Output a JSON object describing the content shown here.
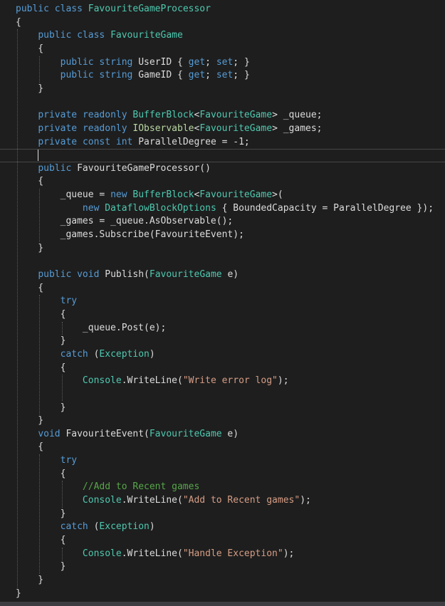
{
  "editor": {
    "lines": [
      [
        {
          "t": "public",
          "c": "kw"
        },
        {
          "t": " ",
          "c": "pl"
        },
        {
          "t": "class",
          "c": "kw"
        },
        {
          "t": " ",
          "c": "pl"
        },
        {
          "t": "FavouriteGameProcessor",
          "c": "typ"
        }
      ],
      [
        {
          "t": "{",
          "c": "pl"
        }
      ],
      [
        {
          "t": "    ",
          "c": "pl"
        },
        {
          "t": "public",
          "c": "kw"
        },
        {
          "t": " ",
          "c": "pl"
        },
        {
          "t": "class",
          "c": "kw"
        },
        {
          "t": " ",
          "c": "pl"
        },
        {
          "t": "FavouriteGame",
          "c": "typ"
        }
      ],
      [
        {
          "t": "    {",
          "c": "pl"
        }
      ],
      [
        {
          "t": "        ",
          "c": "pl"
        },
        {
          "t": "public",
          "c": "kw"
        },
        {
          "t": " ",
          "c": "pl"
        },
        {
          "t": "string",
          "c": "kw"
        },
        {
          "t": " UserID { ",
          "c": "pl"
        },
        {
          "t": "get",
          "c": "kw"
        },
        {
          "t": "; ",
          "c": "pl"
        },
        {
          "t": "set",
          "c": "kw"
        },
        {
          "t": "; }",
          "c": "pl"
        }
      ],
      [
        {
          "t": "        ",
          "c": "pl"
        },
        {
          "t": "public",
          "c": "kw"
        },
        {
          "t": " ",
          "c": "pl"
        },
        {
          "t": "string",
          "c": "kw"
        },
        {
          "t": " GameID { ",
          "c": "pl"
        },
        {
          "t": "get",
          "c": "kw"
        },
        {
          "t": "; ",
          "c": "pl"
        },
        {
          "t": "set",
          "c": "kw"
        },
        {
          "t": "; }",
          "c": "pl"
        }
      ],
      [
        {
          "t": "    }",
          "c": "pl"
        }
      ],
      [],
      [
        {
          "t": "    ",
          "c": "pl"
        },
        {
          "t": "private",
          "c": "kw"
        },
        {
          "t": " ",
          "c": "pl"
        },
        {
          "t": "readonly",
          "c": "kw"
        },
        {
          "t": " ",
          "c": "pl"
        },
        {
          "t": "BufferBlock",
          "c": "typ"
        },
        {
          "t": "<",
          "c": "pl"
        },
        {
          "t": "FavouriteGame",
          "c": "typ"
        },
        {
          "t": "> _queue;",
          "c": "pl"
        }
      ],
      [
        {
          "t": "    ",
          "c": "pl"
        },
        {
          "t": "private",
          "c": "kw"
        },
        {
          "t": " ",
          "c": "pl"
        },
        {
          "t": "readonly",
          "c": "kw"
        },
        {
          "t": " ",
          "c": "pl"
        },
        {
          "t": "IObservable",
          "c": "iface"
        },
        {
          "t": "<",
          "c": "pl"
        },
        {
          "t": "FavouriteGame",
          "c": "typ"
        },
        {
          "t": "> _games;",
          "c": "pl"
        }
      ],
      [
        {
          "t": "    ",
          "c": "pl"
        },
        {
          "t": "private",
          "c": "kw"
        },
        {
          "t": " ",
          "c": "pl"
        },
        {
          "t": "const",
          "c": "kw"
        },
        {
          "t": " ",
          "c": "pl"
        },
        {
          "t": "int",
          "c": "kw"
        },
        {
          "t": " ParallelDegree = -1;",
          "c": "pl"
        }
      ],
      [],
      [
        {
          "t": "    ",
          "c": "pl"
        },
        {
          "t": "public",
          "c": "kw"
        },
        {
          "t": " FavouriteGameProcessor()",
          "c": "pl"
        }
      ],
      [
        {
          "t": "    {",
          "c": "pl"
        }
      ],
      [
        {
          "t": "        _queue = ",
          "c": "pl"
        },
        {
          "t": "new",
          "c": "kw"
        },
        {
          "t": " ",
          "c": "pl"
        },
        {
          "t": "BufferBlock",
          "c": "typ"
        },
        {
          "t": "<",
          "c": "pl"
        },
        {
          "t": "FavouriteGame",
          "c": "typ"
        },
        {
          "t": ">(",
          "c": "pl"
        }
      ],
      [
        {
          "t": "            ",
          "c": "pl"
        },
        {
          "t": "new",
          "c": "kw"
        },
        {
          "t": " ",
          "c": "pl"
        },
        {
          "t": "DataflowBlockOptions",
          "c": "typ"
        },
        {
          "t": " { BoundedCapacity = ParallelDegree });",
          "c": "pl"
        }
      ],
      [
        {
          "t": "        _games = _queue.AsObservable();",
          "c": "pl"
        }
      ],
      [
        {
          "t": "        _games.Subscribe(FavouriteEvent);",
          "c": "pl"
        }
      ],
      [
        {
          "t": "    }",
          "c": "pl"
        }
      ],
      [],
      [
        {
          "t": "    ",
          "c": "pl"
        },
        {
          "t": "public",
          "c": "kw"
        },
        {
          "t": " ",
          "c": "pl"
        },
        {
          "t": "void",
          "c": "kw"
        },
        {
          "t": " Publish(",
          "c": "pl"
        },
        {
          "t": "FavouriteGame",
          "c": "typ"
        },
        {
          "t": " e)",
          "c": "pl"
        }
      ],
      [
        {
          "t": "    {",
          "c": "pl"
        }
      ],
      [
        {
          "t": "        ",
          "c": "pl"
        },
        {
          "t": "try",
          "c": "kw"
        }
      ],
      [
        {
          "t": "        {",
          "c": "pl"
        }
      ],
      [
        {
          "t": "            _queue.Post(e);",
          "c": "pl"
        }
      ],
      [
        {
          "t": "        }",
          "c": "pl"
        }
      ],
      [
        {
          "t": "        ",
          "c": "pl"
        },
        {
          "t": "catch",
          "c": "kw"
        },
        {
          "t": " (",
          "c": "pl"
        },
        {
          "t": "Exception",
          "c": "typ"
        },
        {
          "t": ")",
          "c": "pl"
        }
      ],
      [
        {
          "t": "        {",
          "c": "pl"
        }
      ],
      [
        {
          "t": "            ",
          "c": "pl"
        },
        {
          "t": "Console",
          "c": "typ"
        },
        {
          "t": ".WriteLine(",
          "c": "pl"
        },
        {
          "t": "\"Write error log\"",
          "c": "str"
        },
        {
          "t": ");",
          "c": "pl"
        }
      ],
      [],
      [
        {
          "t": "        }",
          "c": "pl"
        }
      ],
      [
        {
          "t": "    }",
          "c": "pl"
        }
      ],
      [
        {
          "t": "    ",
          "c": "pl"
        },
        {
          "t": "void",
          "c": "kw"
        },
        {
          "t": " FavouriteEvent(",
          "c": "pl"
        },
        {
          "t": "FavouriteGame",
          "c": "typ"
        },
        {
          "t": " e)",
          "c": "pl"
        }
      ],
      [
        {
          "t": "    {",
          "c": "pl"
        }
      ],
      [
        {
          "t": "        ",
          "c": "pl"
        },
        {
          "t": "try",
          "c": "kw"
        }
      ],
      [
        {
          "t": "        {",
          "c": "pl"
        }
      ],
      [
        {
          "t": "            ",
          "c": "pl"
        },
        {
          "t": "//Add to Recent games",
          "c": "cm"
        }
      ],
      [
        {
          "t": "            ",
          "c": "pl"
        },
        {
          "t": "Console",
          "c": "typ"
        },
        {
          "t": ".WriteLine(",
          "c": "pl"
        },
        {
          "t": "\"Add to Recent games\"",
          "c": "str"
        },
        {
          "t": ");",
          "c": "pl"
        }
      ],
      [
        {
          "t": "        }",
          "c": "pl"
        }
      ],
      [
        {
          "t": "        ",
          "c": "pl"
        },
        {
          "t": "catch",
          "c": "kw"
        },
        {
          "t": " (",
          "c": "pl"
        },
        {
          "t": "Exception",
          "c": "typ"
        },
        {
          "t": ")",
          "c": "pl"
        }
      ],
      [
        {
          "t": "        {",
          "c": "pl"
        }
      ],
      [
        {
          "t": "            ",
          "c": "pl"
        },
        {
          "t": "Console",
          "c": "typ"
        },
        {
          "t": ".WriteLine(",
          "c": "pl"
        },
        {
          "t": "\"Handle Exception\"",
          "c": "str"
        },
        {
          "t": ");",
          "c": "pl"
        }
      ],
      [
        {
          "t": "        }",
          "c": "pl"
        }
      ],
      [
        {
          "t": "    }",
          "c": "pl"
        }
      ],
      [
        {
          "t": "}",
          "c": "pl"
        }
      ]
    ],
    "current_line": 11,
    "colors": {
      "background": "#1e1e1e",
      "keyword": "#569cd6",
      "type": "#4ec9b0",
      "interface": "#b8d7a3",
      "string": "#d69d85",
      "comment": "#57a64a",
      "plain": "#dcdcdc"
    }
  }
}
